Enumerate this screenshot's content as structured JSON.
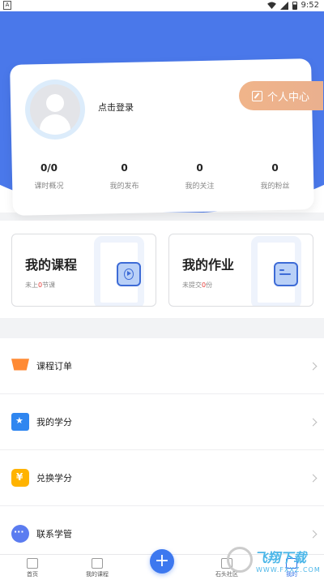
{
  "status_bar": {
    "left_icon": "A",
    "time": "9:52"
  },
  "profile": {
    "login_text": "点击登录",
    "personal_center": "个人中心",
    "stats": [
      {
        "value": "0/0",
        "label": "课时概况"
      },
      {
        "value": "0",
        "label": "我的发布"
      },
      {
        "value": "0",
        "label": "我的关注"
      },
      {
        "value": "0",
        "label": "我的粉丝"
      }
    ]
  },
  "tiles": {
    "courses": {
      "title": "我的课程",
      "sub_pre": "未上",
      "sub_num": "0",
      "sub_post": "节课"
    },
    "homework": {
      "title": "我的作业",
      "sub_pre": "未提交",
      "sub_num": "0",
      "sub_post": "份"
    }
  },
  "menu": [
    {
      "label": "课程订单",
      "icon": "cart-icon"
    },
    {
      "label": "我的学分",
      "icon": "star-icon"
    },
    {
      "label": "兑换学分",
      "icon": "yen-icon"
    },
    {
      "label": "联系学管",
      "icon": "chat-icon"
    }
  ],
  "bottom_nav": [
    {
      "label": "首页"
    },
    {
      "label": "我的课程"
    },
    {
      "label": "石头社区"
    },
    {
      "label": "我的"
    }
  ],
  "watermark": {
    "text": "飞翔下载",
    "url": "WWW.FXXZ.COM"
  },
  "colors": {
    "primary": "#4a78ea",
    "accent": "#f0b48a",
    "red": "#e53935"
  }
}
